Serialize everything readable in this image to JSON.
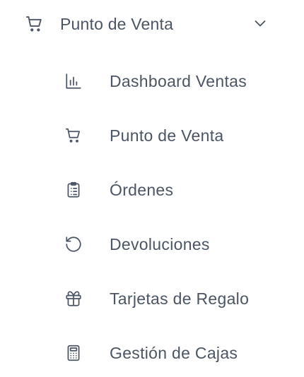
{
  "section": {
    "label": "Punto de Venta",
    "icon": "shopping-cart-icon",
    "expanded": true,
    "chevron_icon": "chevron-down-icon"
  },
  "items": [
    {
      "label": "Dashboard Ventas",
      "icon": "bar-chart-icon"
    },
    {
      "label": "Punto de Venta",
      "icon": "shopping-cart-icon"
    },
    {
      "label": "Órdenes",
      "icon": "clipboard-list-icon"
    },
    {
      "label": "Devoluciones",
      "icon": "rotate-ccw-icon"
    },
    {
      "label": "Tarjetas de Regalo",
      "icon": "gift-icon"
    },
    {
      "label": "Gestión de Cajas",
      "icon": "calculator-icon"
    }
  ],
  "colors": {
    "text": "#4b5563",
    "background": "#ffffff"
  }
}
